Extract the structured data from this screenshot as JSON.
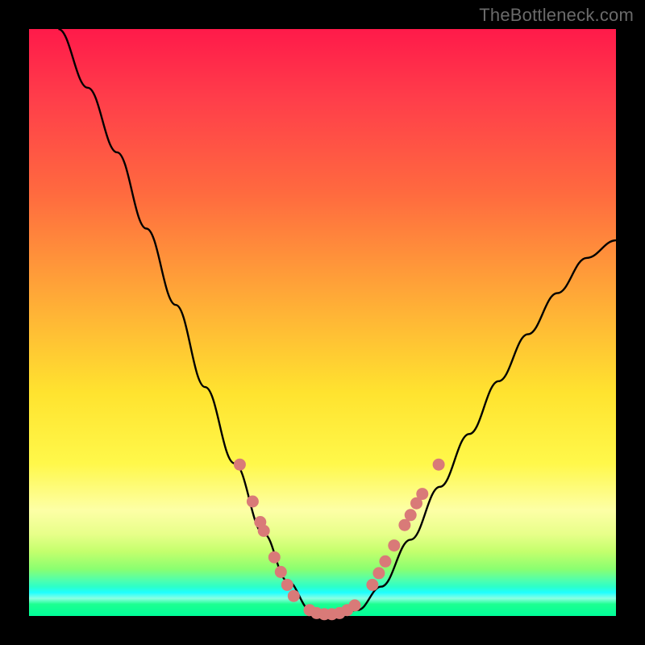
{
  "watermark": "TheBottleneck.com",
  "colors": {
    "background": "#000000",
    "curve": "#000000",
    "marker_fill": "#d97a78",
    "marker_stroke": "#d97a78"
  },
  "chart_data": {
    "type": "line",
    "title": "",
    "xlabel": "",
    "ylabel": "",
    "xlim": [
      0,
      1
    ],
    "ylim": [
      0,
      1
    ],
    "x": [
      0.05,
      0.1,
      0.15,
      0.2,
      0.25,
      0.3,
      0.35,
      0.4,
      0.44,
      0.48,
      0.52,
      0.56,
      0.6,
      0.65,
      0.7,
      0.75,
      0.8,
      0.85,
      0.9,
      0.95,
      1.0
    ],
    "values": [
      1.0,
      0.9,
      0.79,
      0.66,
      0.53,
      0.39,
      0.26,
      0.14,
      0.06,
      0.01,
      0.0,
      0.01,
      0.05,
      0.13,
      0.22,
      0.31,
      0.4,
      0.48,
      0.55,
      0.61,
      0.64
    ],
    "markers": [
      {
        "x": 0.359,
        "y": 0.258
      },
      {
        "x": 0.381,
        "y": 0.195
      },
      {
        "x": 0.394,
        "y": 0.16
      },
      {
        "x": 0.4,
        "y": 0.145
      },
      {
        "x": 0.418,
        "y": 0.1
      },
      {
        "x": 0.429,
        "y": 0.075
      },
      {
        "x": 0.44,
        "y": 0.053
      },
      {
        "x": 0.451,
        "y": 0.034
      },
      {
        "x": 0.478,
        "y": 0.01
      },
      {
        "x": 0.49,
        "y": 0.005
      },
      {
        "x": 0.503,
        "y": 0.003
      },
      {
        "x": 0.516,
        "y": 0.003
      },
      {
        "x": 0.529,
        "y": 0.005
      },
      {
        "x": 0.542,
        "y": 0.01
      },
      {
        "x": 0.555,
        "y": 0.018
      },
      {
        "x": 0.585,
        "y": 0.053
      },
      {
        "x": 0.596,
        "y": 0.073
      },
      {
        "x": 0.607,
        "y": 0.093
      },
      {
        "x": 0.622,
        "y": 0.12
      },
      {
        "x": 0.64,
        "y": 0.155
      },
      {
        "x": 0.65,
        "y": 0.172
      },
      {
        "x": 0.66,
        "y": 0.192
      },
      {
        "x": 0.67,
        "y": 0.208
      },
      {
        "x": 0.698,
        "y": 0.258
      }
    ]
  }
}
